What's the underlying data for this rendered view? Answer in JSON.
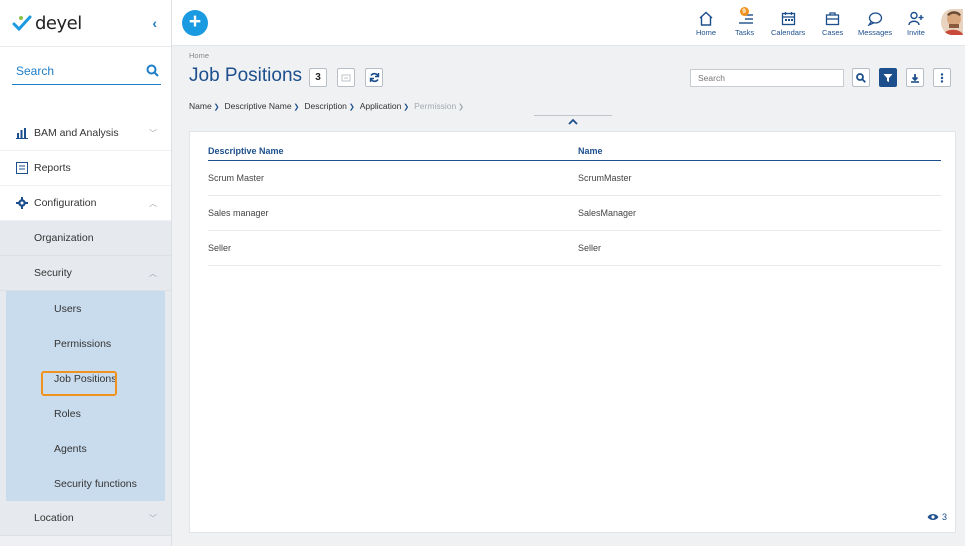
{
  "sidebar": {
    "logo": "deyel",
    "search_label": "Search",
    "items": [
      {
        "label": "BAM and Analysis"
      },
      {
        "label": "Reports"
      },
      {
        "label": "Configuration"
      },
      {
        "label": "Organization"
      },
      {
        "label": "Security"
      },
      {
        "label": "Users"
      },
      {
        "label": "Permissions"
      },
      {
        "label": "Job Positions"
      },
      {
        "label": "Roles"
      },
      {
        "label": "Agents"
      },
      {
        "label": "Security functions"
      },
      {
        "label": "Location"
      }
    ]
  },
  "topbar": {
    "tools": [
      {
        "label": "Home",
        "icon": "home-icon"
      },
      {
        "label": "Tasks",
        "icon": "tasks-icon",
        "badge": "9"
      },
      {
        "label": "Calendars",
        "icon": "calendar-icon"
      },
      {
        "label": "Cases",
        "icon": "briefcase-icon"
      },
      {
        "label": "Messages",
        "icon": "chat-icon"
      },
      {
        "label": "Invite",
        "icon": "invite-icon"
      }
    ]
  },
  "main": {
    "breadcrumb": "Home",
    "title": "Job Positions",
    "count": "3",
    "search_placeholder": "Search",
    "filters": [
      {
        "label": "Name",
        "enabled": true
      },
      {
        "label": "Descriptive Name",
        "enabled": true
      },
      {
        "label": "Description",
        "enabled": true
      },
      {
        "label": "Application",
        "enabled": true
      },
      {
        "label": "Permission",
        "enabled": false
      }
    ],
    "table": {
      "columns": [
        "Descriptive Name",
        "Name"
      ],
      "rows": [
        [
          "Scrum Master",
          "ScrumMaster"
        ],
        [
          "Sales manager",
          "SalesManager"
        ],
        [
          "Seller",
          "Seller"
        ]
      ]
    },
    "footer_count": "3"
  },
  "colors": {
    "accent": "#1d4f8c",
    "brand_blue": "#1a9ae0",
    "highlight": "#f0921e"
  }
}
